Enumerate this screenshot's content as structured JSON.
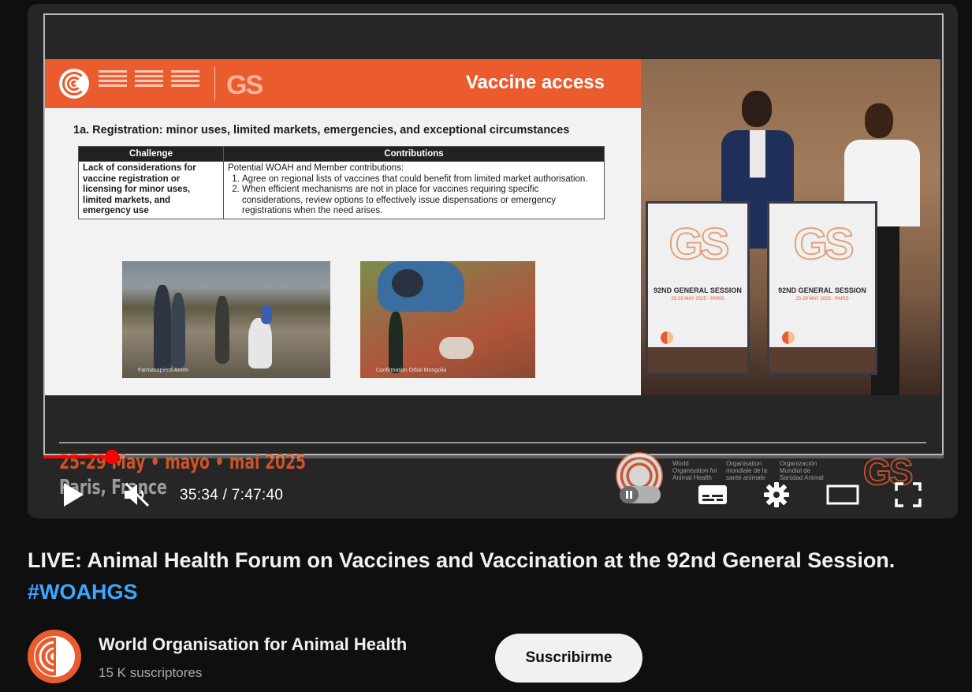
{
  "player": {
    "slide": {
      "header_title": "Vaccine access",
      "gs_mark": "GS",
      "subtitle": "1a. Registration: minor uses, limited markets, emergencies, and exceptional circumstances",
      "table": {
        "headers": [
          "Challenge",
          "Contributions"
        ],
        "challenge": "Lack of considerations for vaccine registration or licensing for minor uses, limited markets, and emergency use",
        "contributions_intro": "Potential WOAH and Member contributions:",
        "contributions": [
          "Agree on regional lists of vaccines that could benefit from limited market authorisation.",
          "When efficient mechanisms are not in place for vaccines requiring specific considerations, review options to effectively issue dispensations or emergency registrations when the need arises."
        ]
      },
      "photo_captions": [
        "Farmasapiens Amen",
        "Confirmation Orbal Mongolia"
      ]
    },
    "stage": {
      "podium_gs": "GS",
      "podium_session": "92ND GENERAL SESSION",
      "podium_dates": "25-29 MAY 2025 - PARIS"
    },
    "overlay": {
      "dates": "25-29 May • mayo • mai 2025",
      "place": "Paris, France",
      "watermark_gs": "GS",
      "watermark_org": [
        "World Organisation for Animal Health",
        "Organisation mondiale de la santé animale",
        "Organización Mundial de Sanidad Animal"
      ]
    },
    "progress": {
      "current": "35:34",
      "total": "7:47:40",
      "fraction": 0.076
    },
    "time_display": "35:34 / 7:47:40",
    "controls": {
      "play_icon": "play-icon",
      "mute_icon": "muted-volume-icon",
      "autoplay_icon": "autoplay-toggle-icon",
      "cc_icon": "subtitles-icon",
      "settings_icon": "gear-icon",
      "theater_icon": "theater-mode-icon",
      "fullscreen_icon": "fullscreen-icon"
    },
    "accent_color": "#ff0000"
  },
  "video": {
    "title_main": "LIVE: Animal Health Forum on Vaccines and Vaccination at the 92nd General Session.",
    "title_hashtag": "#WOAHGS",
    "hashtag_color": "#3ea6ff"
  },
  "channel": {
    "name": "World Organisation for Animal Health",
    "subscribers": "15 K suscriptores",
    "subscribe_label": "Suscribirme",
    "brand_color": "#ea5b2d"
  }
}
